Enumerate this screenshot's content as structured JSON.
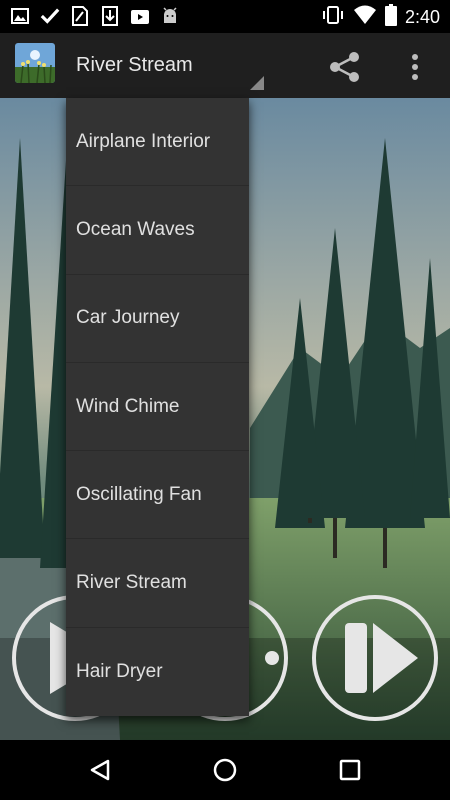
{
  "status_bar": {
    "time": "2:40",
    "left_icons": [
      "image-icon",
      "check-icon",
      "sim-icon",
      "download-icon",
      "play-store-icon",
      "android-icon"
    ],
    "right_icons": [
      "vibrate-icon",
      "wifi-icon",
      "battery-icon"
    ]
  },
  "app_bar": {
    "title": "River Stream",
    "share_icon": "share-icon",
    "overflow_icon": "more-vertical-icon"
  },
  "dropdown": {
    "items": [
      {
        "label": "Airplane Interior"
      },
      {
        "label": "Ocean Waves"
      },
      {
        "label": "Car Journey"
      },
      {
        "label": "Wind Chime"
      },
      {
        "label": "Oscillating Fan"
      },
      {
        "label": "River Stream"
      },
      {
        "label": "Hair Dryer"
      }
    ]
  },
  "controls": {
    "play_icon": "play-icon",
    "timer_icon": "timer-icon",
    "next_icon": "skip-next-icon"
  },
  "nav_bar": {
    "back_icon": "back-icon",
    "home_icon": "home-icon",
    "recents_icon": "recents-icon"
  },
  "colors": {
    "appbar": "#1f1f1f",
    "dropdown": "#333333",
    "text": "#e0e0e0"
  }
}
